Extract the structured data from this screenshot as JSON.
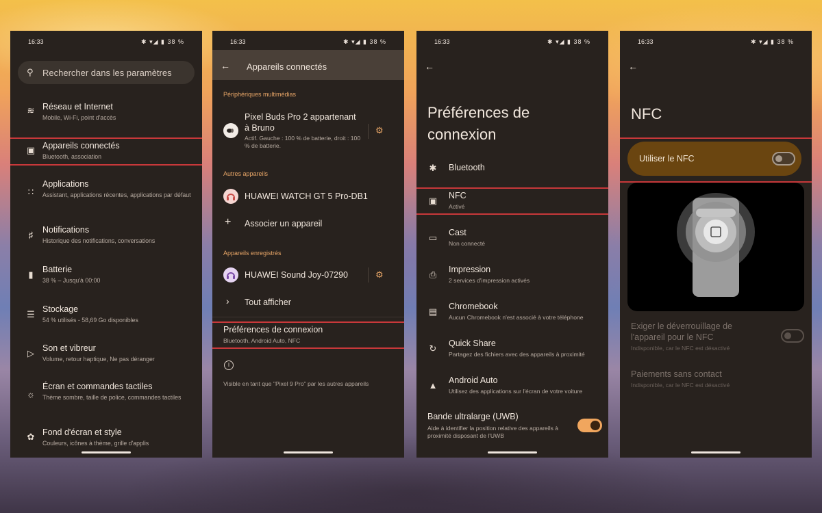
{
  "status": {
    "time": "16:33",
    "icons": "✱ ▾◢ ▮ 38 %"
  },
  "screen1": {
    "search_placeholder": "Rechercher dans les paramètres",
    "items": [
      {
        "title": "Réseau et Internet",
        "subtitle": "Mobile, Wi-Fi, point d'accès",
        "icon": "wifi-icon"
      },
      {
        "title": "Appareils connectés",
        "subtitle": "Bluetooth, association",
        "icon": "devices-icon"
      },
      {
        "title": "Applications",
        "subtitle": "Assistant, applications récentes, applications par défaut",
        "icon": "apps-icon"
      },
      {
        "title": "Notifications",
        "subtitle": "Historique des notifications, conversations",
        "icon": "bell-icon"
      },
      {
        "title": "Batterie",
        "subtitle": "38 % – Jusqu'à 00:00",
        "icon": "battery-icon"
      },
      {
        "title": "Stockage",
        "subtitle": "54 % utilisés - 58,69 Go disponibles",
        "icon": "storage-icon"
      },
      {
        "title": "Son et vibreur",
        "subtitle": "Volume, retour haptique, Ne pas déranger",
        "icon": "volume-icon"
      },
      {
        "title": "Écran et commandes tactiles",
        "subtitle": "Thème sombre, taille de police, commandes tactiles",
        "icon": "display-icon"
      },
      {
        "title": "Fond d'écran et style",
        "subtitle": "Couleurs, icônes à thème, grille d'applis",
        "icon": "palette-icon"
      }
    ]
  },
  "screen2": {
    "title": "Appareils connectés",
    "section_media": "Périphériques multimédias",
    "buds_name": "Pixel Buds Pro 2 appartenant à Bruno",
    "buds_status": "Actif. Gauche : 100 % de batterie, droit : 100 % de batterie.",
    "section_other": "Autres appareils",
    "watch_name": "HUAWEI WATCH GT 5 Pro-DB1",
    "pair_label": "Associer un appareil",
    "section_saved": "Appareils enregistrés",
    "sound_name": "HUAWEI Sound Joy-07290",
    "see_all": "Tout afficher",
    "prefs_title": "Préférences de connexion",
    "prefs_subtitle": "Bluetooth, Android Auto, NFC",
    "visible_text": "Visible en tant que \"Pixel 9 Pro\" par les autres appareils"
  },
  "screen3": {
    "title": "Préférences de connexion",
    "items": [
      {
        "title": "Bluetooth",
        "subtitle": "",
        "icon": "bluetooth-icon"
      },
      {
        "title": "NFC",
        "subtitle": "Activé",
        "icon": "nfc-icon"
      },
      {
        "title": "Cast",
        "subtitle": "Non connecté",
        "icon": "cast-icon"
      },
      {
        "title": "Impression",
        "subtitle": "2 services d'impression activés",
        "icon": "print-icon"
      },
      {
        "title": "Chromebook",
        "subtitle": "Aucun Chromebook n'est associé à votre téléphone",
        "icon": "chromebook-icon"
      },
      {
        "title": "Quick Share",
        "subtitle": "Partagez des fichiers avec des appareils à proximité",
        "icon": "quickshare-icon"
      },
      {
        "title": "Android Auto",
        "subtitle": "Utilisez des applications sur l'écran de votre voiture",
        "icon": "android-auto-icon"
      }
    ],
    "uwb_title": "Bande ultralarge (UWB)",
    "uwb_subtitle": "Aide à identifier la position relative des appareils à proximité disposant de l'UWB",
    "uwb_enabled": true
  },
  "screen4": {
    "title": "NFC",
    "use_nfc": "Utiliser le NFC",
    "use_nfc_enabled": false,
    "unlock_title": "Exiger le déverrouillage de l'appareil pour le NFC",
    "unlock_subtitle": "Indisponible, car le NFC est désactivé",
    "pay_title": "Paiements sans contact",
    "pay_subtitle": "Indisponible, car le NFC est désactivé"
  },
  "colors": {
    "accent": "#e7a567",
    "highlight": "#c8383a",
    "panel": "#28221e"
  }
}
